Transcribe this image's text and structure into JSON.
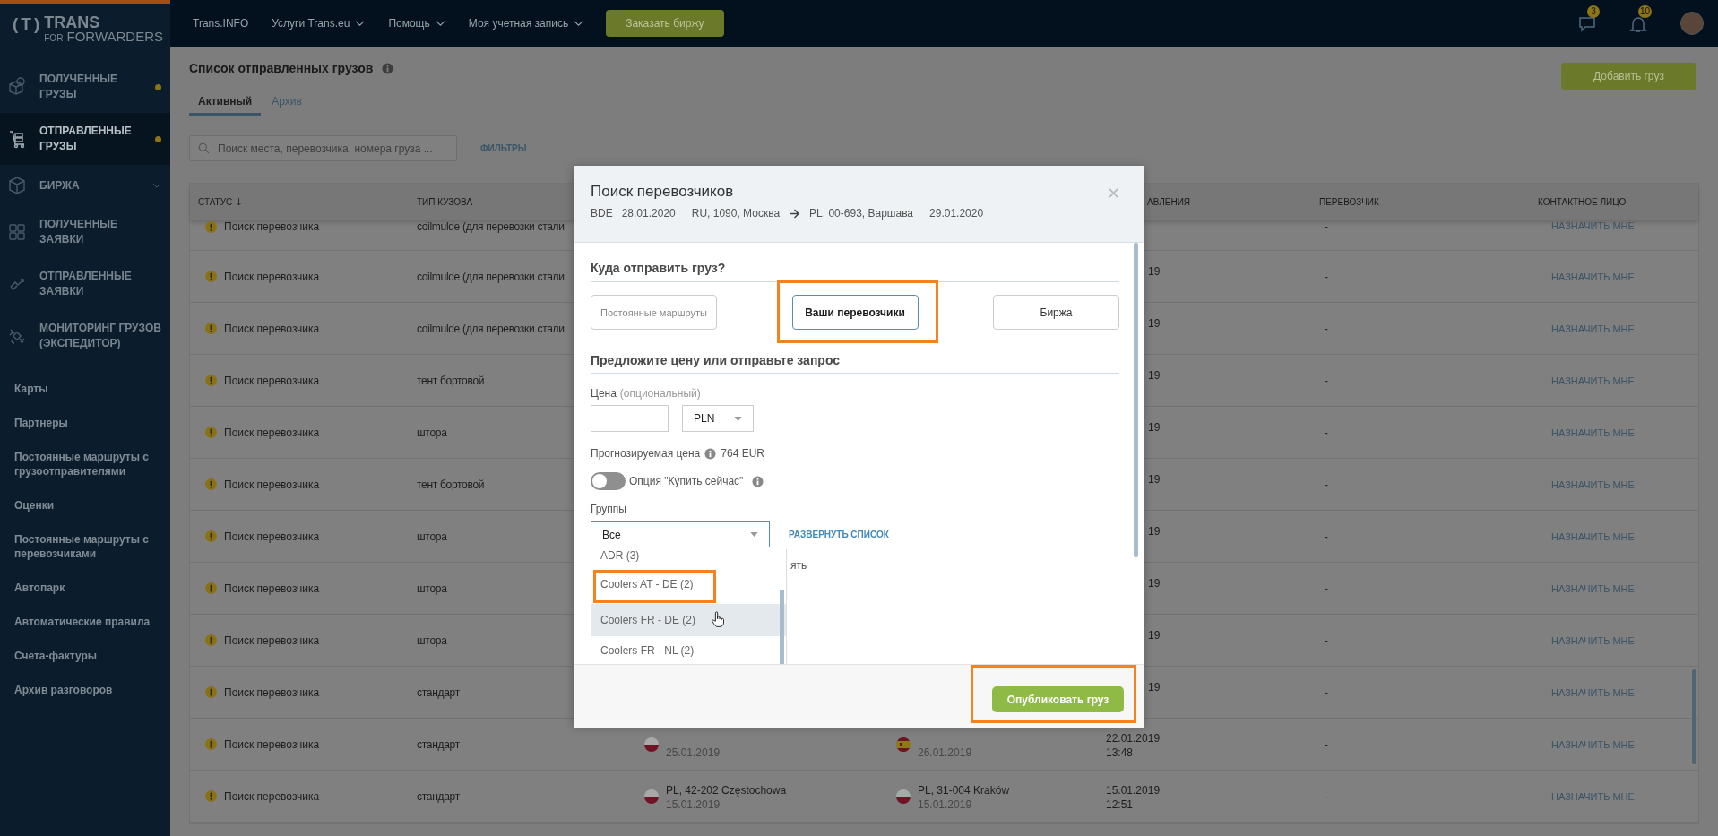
{
  "sidebar": {
    "logo": {
      "mark": "(T)",
      "name": "TRANS",
      "sub_small": "FOR",
      "sub": "FORWARDERS"
    },
    "nav": [
      {
        "label": "ПОЛУЧЕННЫЕ ГРУЗЫ",
        "selected": false,
        "dot": true,
        "expandable": false
      },
      {
        "label": "ОТПРАВЛЕННЫЕ ГРУЗЫ",
        "selected": true,
        "dot": true,
        "expandable": false
      },
      {
        "label": "БИРЖА",
        "selected": false,
        "dot": false,
        "expandable": true
      },
      {
        "label": "ПОЛУЧЕННЫЕ ЗАЯВКИ",
        "selected": false,
        "dot": false,
        "expandable": false
      },
      {
        "label": "ОТПРАВЛЕННЫЕ ЗАЯВКИ",
        "selected": false,
        "dot": false,
        "expandable": false
      },
      {
        "label": "МОНИТОРИНГ ГРУЗОВ (ЭКСПЕДИТОР)",
        "selected": false,
        "dot": false,
        "expandable": false
      }
    ],
    "links": [
      "Карты",
      "Партнеры",
      "Постоянные маршруты с грузоотправителями",
      "Оценки",
      "Постоянные маршруты с перевозчиками",
      "Автопарк",
      "Автоматические правила",
      "Счета-фактуры",
      "Архив разговоров"
    ]
  },
  "topbar": {
    "menu": [
      {
        "label": "Trans.INFO",
        "dropdown": false
      },
      {
        "label": "Услуги Trans.eu",
        "dropdown": true
      },
      {
        "label": "Помощь",
        "dropdown": true
      },
      {
        "label": "Моя учетная запись",
        "dropdown": true
      }
    ],
    "cta": "Заказать биржу",
    "messages_count": "3",
    "notifications_count": "10"
  },
  "page": {
    "title": "Список отправленных грузов",
    "tabs": [
      {
        "label": "Активный",
        "selected": true
      },
      {
        "label": "Архив",
        "selected": false
      }
    ],
    "add_button": "Добавить груз",
    "search": {
      "placeholder": "Поиск места, перевозчика, номера груза ..."
    },
    "filters": "ФИЛЬТРЫ"
  },
  "table": {
    "columns": [
      {
        "label": "СТАТУС",
        "sorted": true
      },
      {
        "label": "ТИП КУЗОВА",
        "sorted": false
      },
      {
        "label": "АВЛЕНИЯ",
        "sorted": false
      },
      {
        "label": "ПЕРЕВОЗЧИК",
        "sorted": false
      },
      {
        "label": "КОНТАКТНОЕ ЛИЦО",
        "sorted": false
      }
    ],
    "rows": [
      {
        "status": "Поиск перевозчика",
        "body_type": "coilmulde (для перевозки стали",
        "carrier": "-",
        "contact": "НАЗНАЧИТЬ МНЕ"
      },
      {
        "status": "Поиск перевозчика",
        "body_type": "coilmulde (для перевозки стали",
        "added": [
          "19"
        ],
        "carrier": "-",
        "contact": "НАЗНАЧИТЬ МНЕ"
      },
      {
        "status": "Поиск перевозчика",
        "body_type": "coilmulde (для перевозки стали",
        "added": [
          "19"
        ],
        "carrier": "-",
        "contact": "НАЗНАЧИТЬ МНЕ"
      },
      {
        "status": "Поиск перевозчика",
        "body_type": "тент бортовой",
        "added": [
          "19"
        ],
        "carrier": "-",
        "contact": "НАЗНАЧИТЬ МНЕ"
      },
      {
        "status": "Поиск перевозчика",
        "body_type": "штора",
        "added": [
          "19"
        ],
        "carrier": "-",
        "contact": "НАЗНАЧИТЬ МНЕ"
      },
      {
        "status": "Поиск перевозчика",
        "body_type": "тент бортовой",
        "added": [
          "19"
        ],
        "carrier": "-",
        "contact": "НАЗНАЧИТЬ МНЕ"
      },
      {
        "status": "Поиск перевозчика",
        "body_type": "штора",
        "added": [
          "19"
        ],
        "carrier": "-",
        "contact": "НАЗНАЧИТЬ МНЕ"
      },
      {
        "status": "Поиск перевозчика",
        "body_type": "штора",
        "added": [
          "19"
        ],
        "carrier": "-",
        "contact": "НАЗНАЧИТЬ МНЕ"
      },
      {
        "status": "Поиск перевозчика",
        "body_type": "штора",
        "added": [
          "19"
        ],
        "carrier": "-",
        "contact": "НАЗНАЧИТЬ МНЕ"
      },
      {
        "status": "Поиск перевозчика",
        "body_type": "стандарт",
        "added": [
          "19"
        ],
        "carrier": "-",
        "contact": "НАЗНАЧИТЬ МНЕ"
      },
      {
        "status": "Поиск перевозчика",
        "body_type": "стандарт",
        "loading": {
          "kind": "pl",
          "date": "25.01.2019"
        },
        "unloading": {
          "kind": "es",
          "date": "26.01.2019"
        },
        "added": [
          "22.01.2019",
          "13:48"
        ],
        "carrier": "-",
        "contact": "НАЗНАЧИТЬ МНЕ"
      },
      {
        "status": "Поиск перевозчика",
        "body_type": "стандарт",
        "loading": {
          "kind": "pl",
          "place": "PL, 42-202 Częstochowa",
          "date": "15.01.2019"
        },
        "unloading": {
          "kind": "pl",
          "place": "PL, 31-004 Kraków",
          "date": "15.01.2019"
        },
        "added": [
          "15.01.2019",
          "12:51"
        ],
        "carrier": "-",
        "contact": "НАЗНАЧИТЬ МНЕ"
      }
    ]
  },
  "dialog": {
    "title": "Поиск перевозчиков",
    "route": {
      "code": "BDE",
      "load_date": "28.01.2020",
      "from": "RU, 1090, Москва",
      "to": "PL, 00-693, Варшава",
      "unload_date": "29.01.2020"
    },
    "section_destination": "Куда отправить груз?",
    "destinations": [
      {
        "label": "Постоянные маршруты",
        "selected": false,
        "annotated": false
      },
      {
        "label": "Ваши перевозчики",
        "selected": true,
        "annotated": true
      },
      {
        "label": "Биржа",
        "selected": false,
        "annotated": false
      }
    ],
    "section_price": "Предложите цену или отправьте запрос",
    "price": {
      "label": "Цена",
      "hint": "(опциональный)",
      "currency": "PLN"
    },
    "forecast": {
      "label": "Прогнозируемая цена",
      "value": "764 EUR"
    },
    "buy_now": {
      "label": "Опция \"Купить сейчас\"",
      "on": false
    },
    "groups": {
      "label": "Группы",
      "value": "Все",
      "expand_link": "РАЗВЕРНУТЬ СПИСОК",
      "hidden_text": "ять",
      "options": [
        {
          "label": "ADR (3)",
          "highlighted": false,
          "annotated": false
        },
        {
          "label": "Coolers AT - DE (2)",
          "highlighted": false,
          "annotated": true
        },
        {
          "label": "Coolers FR - DE (2)",
          "highlighted": true,
          "annotated": false
        },
        {
          "label": "Coolers FR - NL (2)",
          "highlighted": false,
          "annotated": false
        }
      ]
    },
    "publish": {
      "label": "Опубликовать груз",
      "annotated": true
    }
  }
}
